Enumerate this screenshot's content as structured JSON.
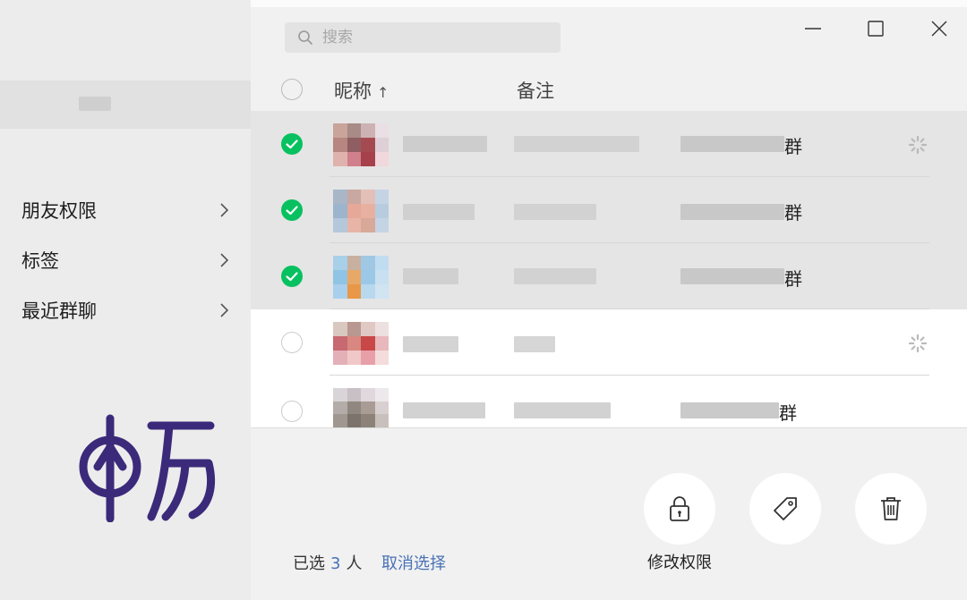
{
  "sidebar": {
    "items": [
      {
        "label": "朋友权限"
      },
      {
        "label": "标签"
      },
      {
        "label": "最近群聊"
      }
    ],
    "logo_text": "畅"
  },
  "search": {
    "placeholder": "搜索"
  },
  "window": {
    "minimize": "minimize",
    "maximize": "maximize",
    "close": "close"
  },
  "table": {
    "headers": {
      "nickname": "昵称",
      "sort_arrow": "↑",
      "remark": "备注"
    },
    "rows": [
      {
        "selected": true,
        "group_suffix": "群",
        "status_icon": true
      },
      {
        "selected": true,
        "group_suffix": "群",
        "status_icon": false
      },
      {
        "selected": true,
        "group_suffix": "群",
        "status_icon": false
      },
      {
        "selected": false,
        "group_suffix": "",
        "status_icon": true
      },
      {
        "selected": false,
        "group_suffix": "群",
        "status_icon": false
      }
    ]
  },
  "footer": {
    "selected_prefix": "已选",
    "selected_count": "3",
    "selected_suffix": "人",
    "cancel_label": "取消选择"
  },
  "actions": [
    {
      "label": "修改权限",
      "icon": "lock-icon"
    },
    {
      "label": "",
      "icon": "tag-icon"
    },
    {
      "label": "",
      "icon": "trash-icon"
    }
  ],
  "colors": {
    "check_green": "#07c160",
    "link_blue": "#4a72b5",
    "logo_purple": "#3b2a7a"
  }
}
